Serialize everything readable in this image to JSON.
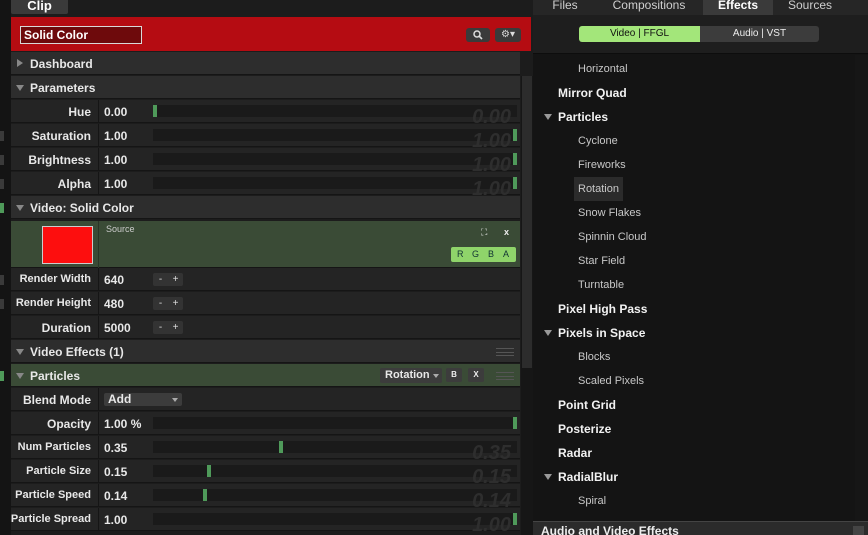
{
  "clip_panel": {
    "tab_label": "Clip",
    "clip_name": "Solid Color",
    "sections": {
      "dashboard": "Dashboard",
      "parameters": "Parameters",
      "video_source": "Video: Solid Color",
      "video_effects": "Video Effects (1)",
      "particles": "Particles"
    },
    "parameters": [
      {
        "label": "Hue",
        "value": "0.00",
        "ghost": "0.00",
        "level": 0.0
      },
      {
        "label": "Saturation",
        "value": "1.00",
        "ghost": "1.00",
        "level": 1.0
      },
      {
        "label": "Brightness",
        "value": "1.00",
        "ghost": "1.00",
        "level": 1.0
      },
      {
        "label": "Alpha",
        "value": "1.00",
        "ghost": "1.00",
        "level": 1.0
      }
    ],
    "source": {
      "label": "Source",
      "expand_glyph": "⛶",
      "close_glyph": "x",
      "color": "#fd0e0e",
      "channels": [
        "R",
        "G",
        "B",
        "A"
      ]
    },
    "render": [
      {
        "label": "Render Width",
        "value": "640"
      },
      {
        "label": "Render Height",
        "value": "480"
      },
      {
        "label": "Duration",
        "value": "5000"
      }
    ],
    "stepper": {
      "minus": "-",
      "plus": "+"
    },
    "effect": {
      "name": "Rotation",
      "bypass_label": "B",
      "remove_label": "X"
    },
    "blend_mode": {
      "label": "Blend Mode",
      "value": "Add"
    },
    "particle_params": [
      {
        "label": "Opacity",
        "value": "1.00 %",
        "ghost": "",
        "level": 1.0
      },
      {
        "label": "Num Particles",
        "value": "0.35",
        "ghost": "0.35",
        "level": 0.35
      },
      {
        "label": "Particle Size",
        "value": "0.15",
        "ghost": "0.15",
        "level": 0.15
      },
      {
        "label": "Particle Speed",
        "value": "0.14",
        "ghost": "0.14",
        "level": 0.14
      },
      {
        "label": "Particle Spread",
        "value": "1.00",
        "ghost": "1.00",
        "level": 1.0
      }
    ]
  },
  "browser": {
    "tabs": [
      "Files",
      "Compositions",
      "Effects",
      "Sources"
    ],
    "active_tab": "Effects",
    "subtabs": [
      "Video | FFGL",
      "Audio | VST"
    ],
    "tree": [
      {
        "label": "Horizontal",
        "level": "child"
      },
      {
        "label": "Mirror Quad",
        "level": "top"
      },
      {
        "label": "Particles",
        "level": "top",
        "expanded": true
      },
      {
        "label": "Cyclone",
        "level": "child"
      },
      {
        "label": "Fireworks",
        "level": "child"
      },
      {
        "label": "Rotation",
        "level": "child",
        "selected": true
      },
      {
        "label": "Snow Flakes",
        "level": "child"
      },
      {
        "label": "Spinnin Cloud",
        "level": "child"
      },
      {
        "label": "Star Field",
        "level": "child"
      },
      {
        "label": "Turntable",
        "level": "child"
      },
      {
        "label": "Pixel High Pass",
        "level": "top"
      },
      {
        "label": "Pixels in Space",
        "level": "top",
        "expanded": true
      },
      {
        "label": "Blocks",
        "level": "child"
      },
      {
        "label": "Scaled Pixels",
        "level": "child"
      },
      {
        "label": "Point Grid",
        "level": "top"
      },
      {
        "label": "Posterize",
        "level": "top"
      },
      {
        "label": "Radar",
        "level": "top"
      },
      {
        "label": "RadialBlur",
        "level": "top",
        "expanded": true
      },
      {
        "label": "Spiral",
        "level": "child"
      }
    ],
    "footer": "Audio and Video Effects"
  },
  "colors": {
    "header_red": "#b50c12",
    "accent_green": "#a3e67a",
    "slider_handle": "#4f9a5a"
  }
}
